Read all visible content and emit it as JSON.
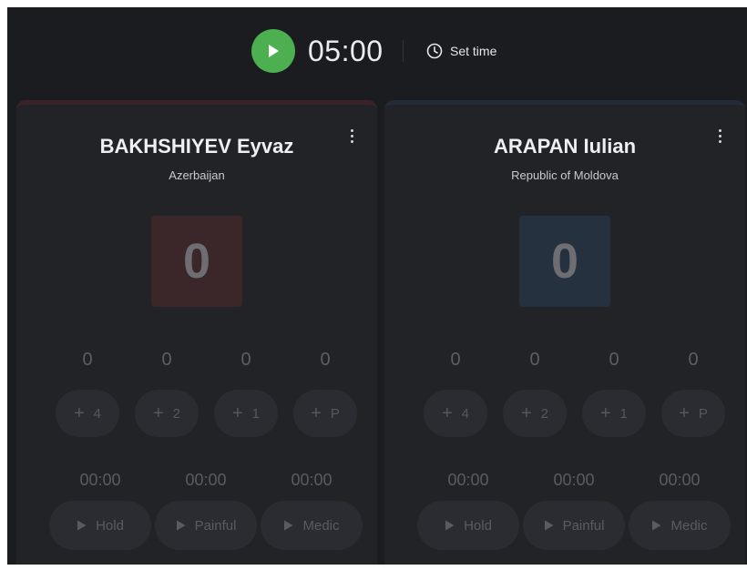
{
  "header": {
    "timer": "05:00",
    "set_time_label": "Set time",
    "play_icon": "play-icon",
    "clock_icon": "clock-icon",
    "play_color": "#4caf50"
  },
  "score_buttons": [
    "4",
    "2",
    "1",
    "P"
  ],
  "action_buttons": [
    "Hold",
    "Painful",
    "Medic"
  ],
  "athletes": [
    {
      "corner": "red",
      "name": "BAKHSHIYEV Eyvaz",
      "country": "Azerbaijan",
      "score": "0",
      "counts": [
        "0",
        "0",
        "0",
        "0"
      ],
      "times": [
        "00:00",
        "00:00",
        "00:00"
      ]
    },
    {
      "corner": "blue",
      "name": "ARAPAN Iulian",
      "country": "Republic of Moldova",
      "score": "0",
      "counts": [
        "0",
        "0",
        "0",
        "0"
      ],
      "times": [
        "00:00",
        "00:00",
        "00:00"
      ]
    }
  ]
}
